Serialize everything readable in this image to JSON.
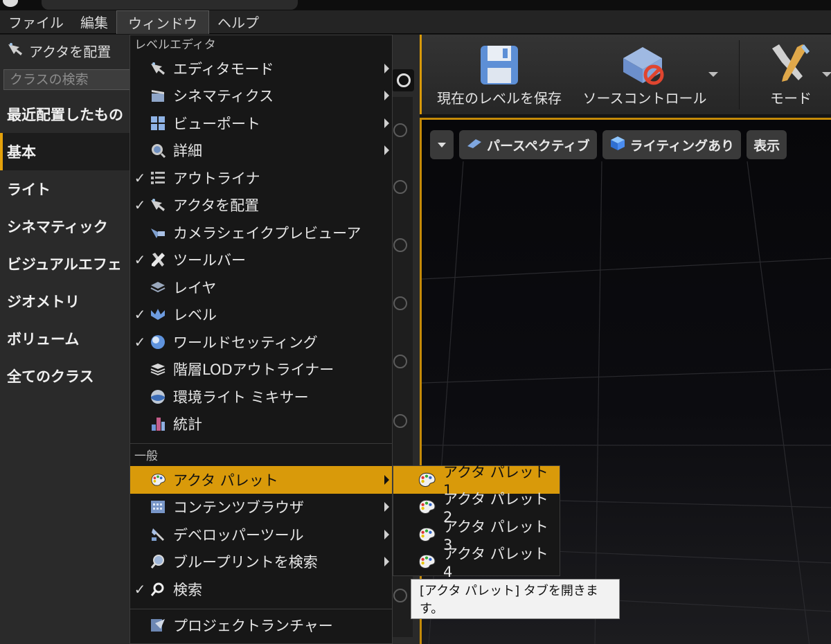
{
  "menubar": {
    "items": [
      {
        "label": "ファイル"
      },
      {
        "label": "編集"
      },
      {
        "label": "ウィンドウ"
      },
      {
        "label": "ヘルプ"
      }
    ]
  },
  "left_panel": {
    "title": "アクタを配置",
    "search_placeholder": "クラスの検索",
    "categories": [
      {
        "label": "最近配置したもの"
      },
      {
        "label": "基本"
      },
      {
        "label": "ライト"
      },
      {
        "label": "シネマティック"
      },
      {
        "label": "ビジュアルエフェ"
      },
      {
        "label": "ジオメトリ"
      },
      {
        "label": "ボリューム"
      },
      {
        "label": "全てのクラス"
      }
    ]
  },
  "toolbar": {
    "save_label": "現在のレベルを保存",
    "source_control_label": "ソースコントロール",
    "modes_label": "モード"
  },
  "viewport": {
    "perspective_label": "パースペクティブ",
    "lighting_label": "ライティングあり",
    "show_label": "表示"
  },
  "window_menu": {
    "section_level_editor": "レベルエディタ",
    "items_level_editor": [
      {
        "label": "エディタモード",
        "checked": false,
        "submenu": true,
        "icon": "editor-modes-icon"
      },
      {
        "label": "シネマティクス",
        "checked": false,
        "submenu": true,
        "icon": "clapper-icon"
      },
      {
        "label": "ビューポート",
        "checked": false,
        "submenu": true,
        "icon": "viewport-grid-icon"
      },
      {
        "label": "詳細",
        "checked": false,
        "submenu": true,
        "icon": "details-magnifier-icon"
      },
      {
        "label": "アウトライナ",
        "checked": true,
        "submenu": false,
        "icon": "outliner-list-icon"
      },
      {
        "label": "アクタを配置",
        "checked": true,
        "submenu": false,
        "icon": "place-actors-icon"
      },
      {
        "label": "カメラシェイクプレビューア",
        "checked": false,
        "submenu": false,
        "icon": "camera-shake-icon"
      },
      {
        "label": "ツールバー",
        "checked": true,
        "submenu": false,
        "icon": "toolbar-tools-icon"
      },
      {
        "label": "レイヤ",
        "checked": false,
        "submenu": false,
        "icon": "layers-icon"
      },
      {
        "label": "レベル",
        "checked": true,
        "submenu": false,
        "icon": "levels-icon"
      },
      {
        "label": "ワールドセッティング",
        "checked": true,
        "submenu": false,
        "icon": "world-globe-icon"
      },
      {
        "label": "階層LODアウトライナー",
        "checked": false,
        "submenu": false,
        "icon": "hlod-stack-icon"
      },
      {
        "label": "環境ライト ミキサー",
        "checked": false,
        "submenu": false,
        "icon": "env-light-sphere-icon"
      },
      {
        "label": "統計",
        "checked": false,
        "submenu": false,
        "icon": "statistics-bars-icon"
      }
    ],
    "section_general": "一般",
    "items_general": [
      {
        "label": "アクタ パレット",
        "checked": false,
        "submenu": true,
        "highlighted": true,
        "icon": "palette-icon"
      },
      {
        "label": "コンテンツブラウザ",
        "checked": false,
        "submenu": true,
        "icon": "content-browser-icon"
      },
      {
        "label": "デベロッパーツール",
        "checked": false,
        "submenu": true,
        "icon": "developer-tools-icon"
      },
      {
        "label": "ブループリントを検索",
        "checked": false,
        "submenu": true,
        "icon": "blueprint-search-icon"
      },
      {
        "label": "検索",
        "checked": true,
        "submenu": false,
        "icon": "search-icon"
      }
    ],
    "items_bottom": [
      {
        "label": "プロジェクトランチャー",
        "checked": false,
        "submenu": false,
        "icon": "project-launcher-icon"
      }
    ]
  },
  "palette_submenu": {
    "items": [
      {
        "label": "アクタ パレット 1",
        "highlighted": true
      },
      {
        "label": "アクタ パレット 2"
      },
      {
        "label": "アクタ パレット 3"
      },
      {
        "label": "アクタ パレット 4"
      }
    ]
  },
  "tooltip": {
    "text": "[アクタ パレット] タブを開きます。"
  },
  "colors": {
    "accent": "#d99a0a",
    "menu_bg": "#171717",
    "panel_bg": "#2a2a2a"
  }
}
